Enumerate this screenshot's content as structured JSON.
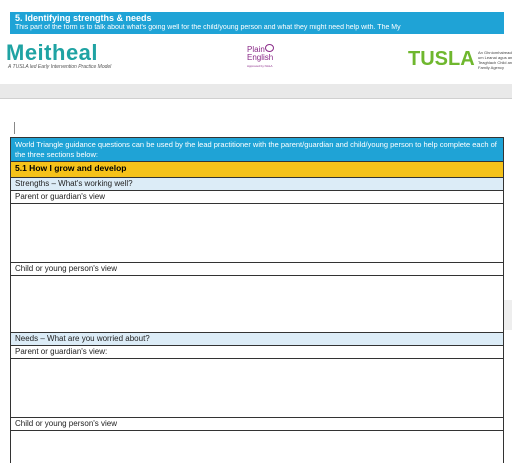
{
  "banner": {
    "title": "5. Identifying strengths & needs",
    "subtitle": "This part of the form is to talk about what's going well for the child/young person and what they might need help with. The My"
  },
  "logos": {
    "meitheal": "Meitheal",
    "meitheal_tagline": "A TUSLA led Early Intervention Practice Model",
    "plain_english": "Plain English",
    "plain_english_sub": "Approved by NALA",
    "tusla": "TUSLA",
    "tusla_side": "An Ghníomhaireacht um Leanaí agus an Teaghlach Child and Family Agency"
  },
  "form": {
    "intro": "World Triangle guidance questions can be used by the lead practitioner with the parent/guardian and child/young person to help complete each of the three sections below:",
    "section_heading": "5.1  How I grow and develop",
    "strengths_label": "Strengths – What's working well?",
    "strengths_parent_label": "Parent or guardian's view",
    "strengths_child_label": "Child or young person's view",
    "needs_label": "Needs – What are you worried about?",
    "needs_parent_label": "Parent or guardian's view:",
    "needs_child_label": "Child or young person's view"
  }
}
